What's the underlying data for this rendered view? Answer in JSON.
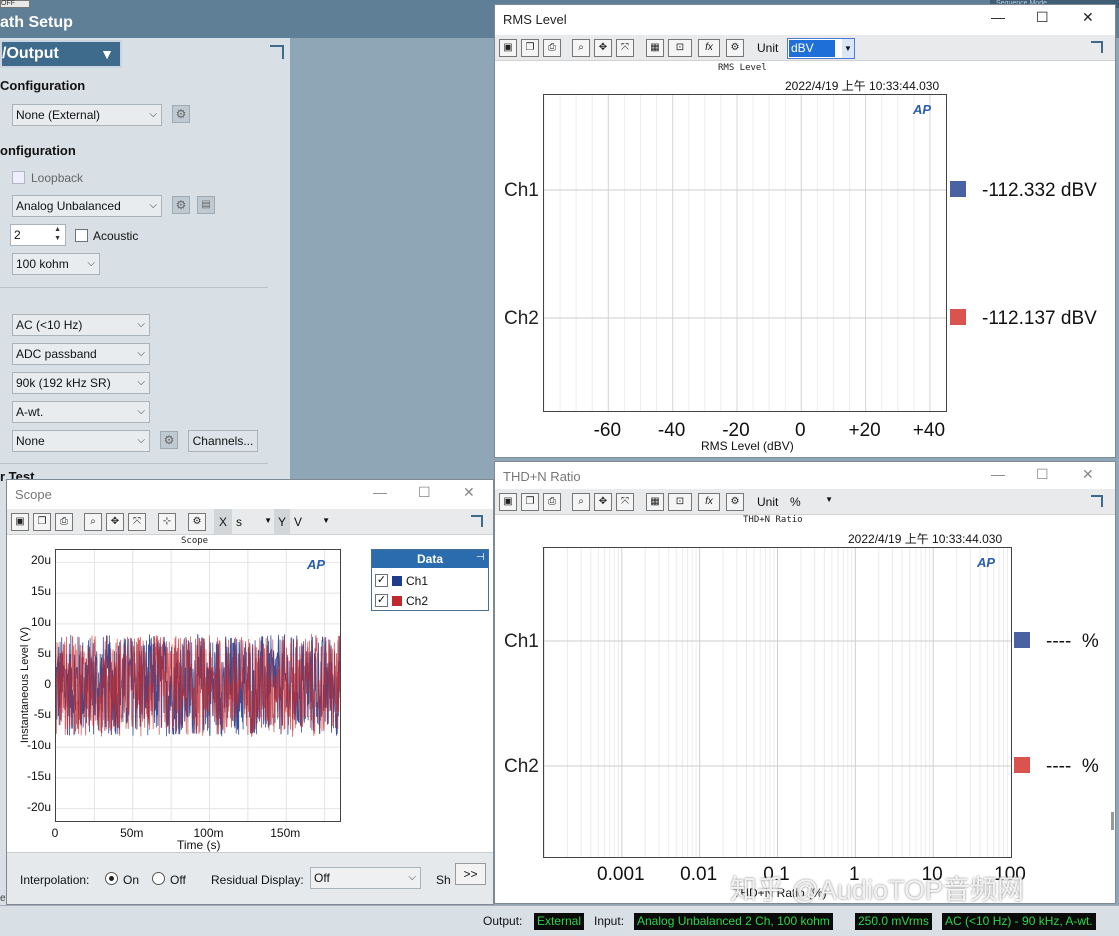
{
  "path_setup": {
    "off_badge": "OFF",
    "title": "ath Setup",
    "header_tab": "Sequence Mode",
    "io_header": "/Output",
    "output_config_label": "Configuration",
    "output_select": "None (External)",
    "input_config_label": "onfiguration",
    "loopback_label": "Loopback",
    "input_select": "Analog Unbalanced",
    "channels_value": "2",
    "acoustic_label": "Acoustic",
    "impedance_select": "100 kohm",
    "coupling_select": "AC (<10 Hz)",
    "bandpass_select": "ADC passband",
    "bandwidth_select": "90k (192 kHz SR)",
    "weighting_select": "A-wt.",
    "filter_select": "None",
    "channels_button": "Channels...",
    "next_section": "r Test",
    "bottom_cut": "ettir"
  },
  "rms_window": {
    "title": "RMS Level",
    "unit_label": "Unit",
    "unit_value": "dBV",
    "chart_title": "RMS Level",
    "timestamp": "2022/4/19 上午 10:33:44.030",
    "logo": "AP",
    "channels": [
      {
        "name": "Ch1",
        "value": "-112.332 dBV",
        "color": "#4a62a2"
      },
      {
        "name": "Ch2",
        "value": "-112.137 dBV",
        "color": "#d9534f"
      }
    ],
    "x_ticks": [
      "-60",
      "-40",
      "-20",
      "0",
      "+20",
      "+40"
    ],
    "xlabel": "RMS Level (dBV)"
  },
  "thd_window": {
    "title": "THD+N Ratio",
    "unit_label": "Unit",
    "unit_value": "%",
    "chart_title": "THD+N Ratio",
    "timestamp": "2022/4/19 上午 10:33:44.030",
    "logo": "AP",
    "channels": [
      {
        "name": "Ch1",
        "value": "----  %",
        "color": "#4a62a2"
      },
      {
        "name": "Ch2",
        "value": "----  %",
        "color": "#d9534f"
      }
    ],
    "x_ticks": [
      "0.001",
      "0.01",
      "0.1",
      "1",
      "10",
      "100"
    ],
    "xlabel": "THD+N Ratio (%)"
  },
  "scope_window": {
    "title": "Scope",
    "x_label_btn": "X",
    "x_unit": "s",
    "y_label_btn": "Y",
    "y_unit": "V",
    "chart_title": "Scope",
    "logo": "AP",
    "ylabel": "Instantaneous Level (V)",
    "xlabel": "Time (s)",
    "y_ticks": [
      "20u",
      "15u",
      "10u",
      "5u",
      "0",
      "-5u",
      "-10u",
      "-15u",
      "-20u"
    ],
    "x_ticks": [
      "0",
      "50m",
      "100m",
      "150m"
    ],
    "legend_title": "Data",
    "legend": [
      {
        "name": "Ch1",
        "color": "#1f3b8c"
      },
      {
        "name": "Ch2",
        "color": "#c0282d"
      }
    ],
    "interpolation_label": "Interpolation:",
    "interp_on": "On",
    "interp_off": "Off",
    "residual_label": "Residual Display:",
    "residual_value": "Off",
    "show_label": "Sh",
    "more_button": ">>"
  },
  "status": {
    "output_label": "Output:",
    "output_value": "External",
    "input_label": "Input:",
    "input_value": "Analog Unbalanced 2 Ch, 100 kohm",
    "level_value": "250.0 mVrms",
    "filter_value": "AC (<10 Hz) - 90 kHz, A-wt."
  },
  "watermark": "知乎 @AudioTOP音频网",
  "chart_data": [
    {
      "type": "bar",
      "title": "RMS Level",
      "xlabel": "RMS Level (dBV)",
      "categories": [
        "Ch1",
        "Ch2"
      ],
      "values": [
        -112.332,
        -112.137
      ],
      "xlim": [
        -80,
        45
      ]
    },
    {
      "type": "bar",
      "title": "THD+N Ratio",
      "xlabel": "THD+N Ratio (%)",
      "categories": [
        "Ch1",
        "Ch2"
      ],
      "values": [
        null,
        null
      ],
      "xlim": [
        0.0001,
        100
      ],
      "x_scale": "log"
    },
    {
      "type": "line",
      "title": "Scope",
      "xlabel": "Time (s)",
      "ylabel": "Instantaneous Level (V)",
      "xlim": [
        0,
        0.2
      ],
      "ylim": [
        -2.2e-05,
        2.2e-05
      ],
      "series": [
        {
          "name": "Ch1",
          "amplitude_range": [
            -9.5e-06,
            1e-05
          ]
        },
        {
          "name": "Ch2",
          "amplitude_range": [
            -9.5e-06,
            1e-05
          ]
        }
      ]
    }
  ]
}
